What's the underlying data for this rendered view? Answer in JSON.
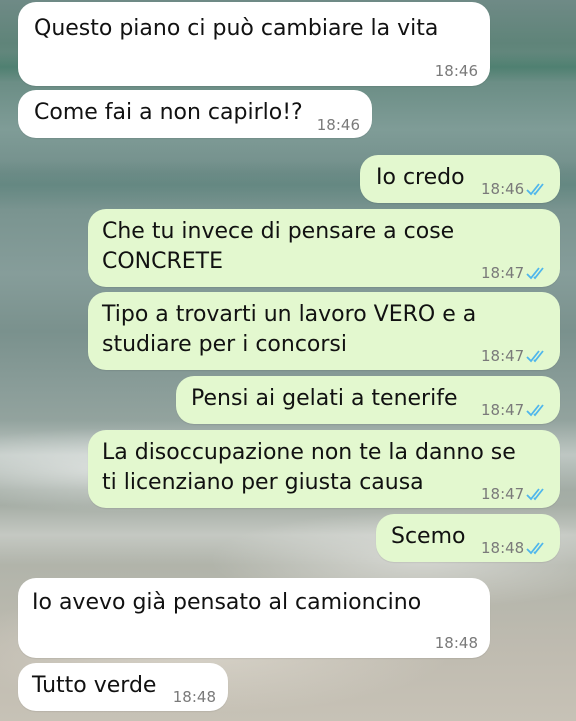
{
  "messages": [
    {
      "direction": "in",
      "text": "Questo piano ci può cambiare la vita",
      "time": "18:46"
    },
    {
      "direction": "in",
      "text": "Come fai a non capirlo!?",
      "time": "18:46"
    },
    {
      "direction": "out",
      "text": "Io credo",
      "time": "18:46",
      "status": "read"
    },
    {
      "direction": "out",
      "text": "Che tu invece di pensare a cose\nCONCRETE",
      "time": "18:47",
      "status": "read"
    },
    {
      "direction": "out",
      "text": "Tipo a trovarti un lavoro VERO e a\nstudiare per i concorsi",
      "time": "18:47",
      "status": "read"
    },
    {
      "direction": "out",
      "text": "Pensi ai gelati a tenerife",
      "time": "18:47",
      "status": "read"
    },
    {
      "direction": "out",
      "text": "La disoccupazione non te la danno se\nti licenziano per giusta causa",
      "time": "18:47",
      "status": "read"
    },
    {
      "direction": "out",
      "text": "Scemo",
      "time": "18:48",
      "status": "read"
    },
    {
      "direction": "in",
      "text": "Io avevo già pensato al camioncino",
      "time": "18:48"
    },
    {
      "direction": "in",
      "text": "Tutto verde",
      "time": "18:48"
    }
  ],
  "colors": {
    "incoming_bubble": "#ffffff",
    "outgoing_bubble": "#e3f8cf",
    "read_ticks": "#4fb6ec",
    "timestamp": "#7a7a7a"
  },
  "icons": {
    "read_receipt": "double-check-icon"
  }
}
